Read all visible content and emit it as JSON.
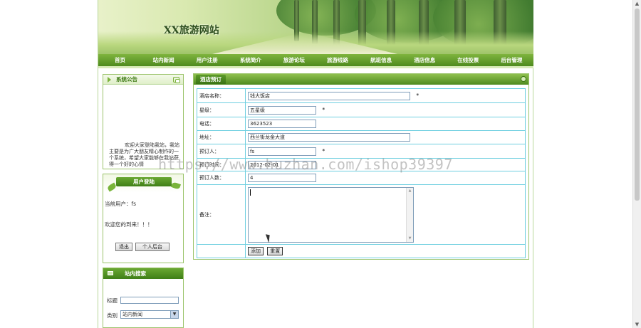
{
  "site": {
    "title": "XX旅游网站"
  },
  "nav": {
    "items": [
      "首页",
      "站内新闻",
      "用户注册",
      "系统简介",
      "旅游论坛",
      "旅游线路",
      "航班信息",
      "酒店信息",
      "在线投票",
      "后台管理"
    ]
  },
  "notice": {
    "title": "系统公告",
    "text": "欢迎大家登陆我站，我站主要是为广大朋友精心制作的一个系统，希望大家能够在我站获得一个好的心情"
  },
  "login": {
    "title": "用户登陆",
    "current_user": "当前用户：fs",
    "welcome": "欢迎您的到来！！！",
    "logout_label": "退出",
    "center_label": "个人后台"
  },
  "search": {
    "title": "站内搜索",
    "keyword_label": "标题",
    "keyword_value": "",
    "category_label": "类别",
    "category_value": "站内新闻"
  },
  "booking": {
    "tab": "酒店预订",
    "hotel_label": "酒店名称：",
    "hotel_value": "钱大饭店",
    "star_label": "星级：",
    "star_value": "五星级",
    "phone_label": "电话：",
    "phone_value": "3623523",
    "address_label": "地址：",
    "address_value": "西兰街龙金大道",
    "booker_label": "预订人：",
    "booker_value": "fs",
    "time_label": "预订时间：",
    "time_value": "2012-02-01",
    "people_label": "预订人数：",
    "people_value": "4",
    "remark_label": "备注：",
    "remark_value": "",
    "required_mark": "*",
    "submit_label": "添加",
    "reset_label": "重置"
  },
  "watermark": "https://www.huzhan.com/ishop39397"
}
